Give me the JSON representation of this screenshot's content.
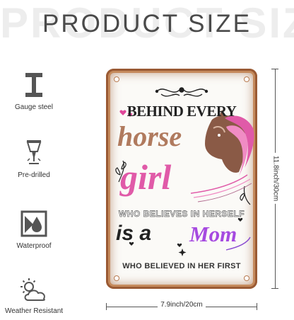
{
  "header": {
    "title": "PRODUCT SIZE",
    "watermark": "PRODUCT SIZE"
  },
  "features": [
    {
      "icon": "i-beam-icon",
      "label": "Gauge steel"
    },
    {
      "icon": "pre-drilled-icon",
      "label": "Pre-drilled"
    },
    {
      "icon": "water-drop-icon",
      "label": "Waterproof"
    },
    {
      "icon": "weather-icon",
      "label": "Weather Resistant"
    }
  ],
  "sign": {
    "line1": "BEHIND EVERY",
    "line2": "horse",
    "line3": "girl",
    "line4": "WHO BELIEVES IN HERSELF",
    "line5a": "is a",
    "line5b": "Mom",
    "line6": "WHO BELIEVED IN HER FIRST",
    "colors": {
      "rust": "#9a5a34",
      "pink": "#e05aa8",
      "purple": "#a64ae0",
      "bronze": "#b07a5e"
    }
  },
  "dimensions": {
    "width_label": "7.9inch/20cm",
    "height_label": "11.8inch/30cm"
  }
}
